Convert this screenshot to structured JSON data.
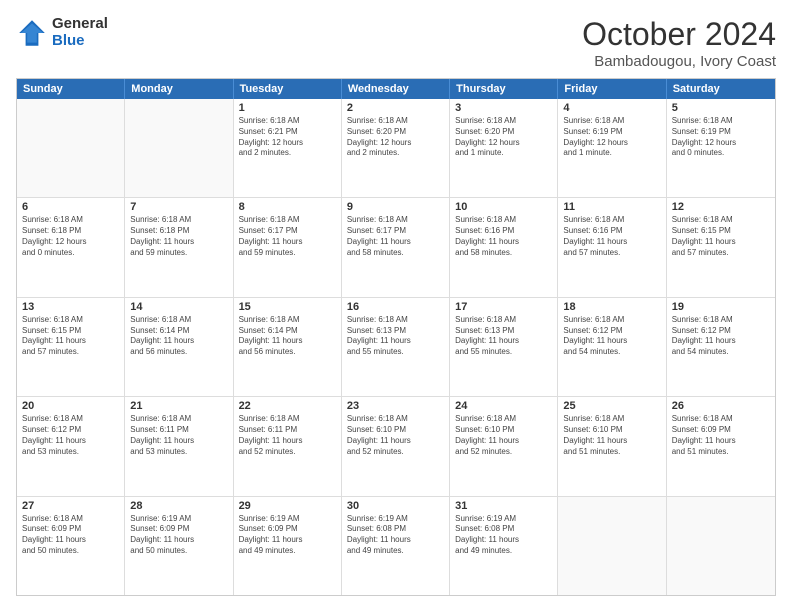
{
  "logo": {
    "general": "General",
    "blue": "Blue"
  },
  "title": "October 2024",
  "location": "Bambadougou, Ivory Coast",
  "header_days": [
    "Sunday",
    "Monday",
    "Tuesday",
    "Wednesday",
    "Thursday",
    "Friday",
    "Saturday"
  ],
  "weeks": [
    [
      {
        "day": "",
        "empty": true,
        "text": ""
      },
      {
        "day": "",
        "empty": true,
        "text": ""
      },
      {
        "day": "1",
        "text": "Sunrise: 6:18 AM\nSunset: 6:21 PM\nDaylight: 12 hours\nand 2 minutes."
      },
      {
        "day": "2",
        "text": "Sunrise: 6:18 AM\nSunset: 6:20 PM\nDaylight: 12 hours\nand 2 minutes."
      },
      {
        "day": "3",
        "text": "Sunrise: 6:18 AM\nSunset: 6:20 PM\nDaylight: 12 hours\nand 1 minute."
      },
      {
        "day": "4",
        "text": "Sunrise: 6:18 AM\nSunset: 6:19 PM\nDaylight: 12 hours\nand 1 minute."
      },
      {
        "day": "5",
        "text": "Sunrise: 6:18 AM\nSunset: 6:19 PM\nDaylight: 12 hours\nand 0 minutes."
      }
    ],
    [
      {
        "day": "6",
        "text": "Sunrise: 6:18 AM\nSunset: 6:18 PM\nDaylight: 12 hours\nand 0 minutes."
      },
      {
        "day": "7",
        "text": "Sunrise: 6:18 AM\nSunset: 6:18 PM\nDaylight: 11 hours\nand 59 minutes."
      },
      {
        "day": "8",
        "text": "Sunrise: 6:18 AM\nSunset: 6:17 PM\nDaylight: 11 hours\nand 59 minutes."
      },
      {
        "day": "9",
        "text": "Sunrise: 6:18 AM\nSunset: 6:17 PM\nDaylight: 11 hours\nand 58 minutes."
      },
      {
        "day": "10",
        "text": "Sunrise: 6:18 AM\nSunset: 6:16 PM\nDaylight: 11 hours\nand 58 minutes."
      },
      {
        "day": "11",
        "text": "Sunrise: 6:18 AM\nSunset: 6:16 PM\nDaylight: 11 hours\nand 57 minutes."
      },
      {
        "day": "12",
        "text": "Sunrise: 6:18 AM\nSunset: 6:15 PM\nDaylight: 11 hours\nand 57 minutes."
      }
    ],
    [
      {
        "day": "13",
        "text": "Sunrise: 6:18 AM\nSunset: 6:15 PM\nDaylight: 11 hours\nand 57 minutes."
      },
      {
        "day": "14",
        "text": "Sunrise: 6:18 AM\nSunset: 6:14 PM\nDaylight: 11 hours\nand 56 minutes."
      },
      {
        "day": "15",
        "text": "Sunrise: 6:18 AM\nSunset: 6:14 PM\nDaylight: 11 hours\nand 56 minutes."
      },
      {
        "day": "16",
        "text": "Sunrise: 6:18 AM\nSunset: 6:13 PM\nDaylight: 11 hours\nand 55 minutes."
      },
      {
        "day": "17",
        "text": "Sunrise: 6:18 AM\nSunset: 6:13 PM\nDaylight: 11 hours\nand 55 minutes."
      },
      {
        "day": "18",
        "text": "Sunrise: 6:18 AM\nSunset: 6:12 PM\nDaylight: 11 hours\nand 54 minutes."
      },
      {
        "day": "19",
        "text": "Sunrise: 6:18 AM\nSunset: 6:12 PM\nDaylight: 11 hours\nand 54 minutes."
      }
    ],
    [
      {
        "day": "20",
        "text": "Sunrise: 6:18 AM\nSunset: 6:12 PM\nDaylight: 11 hours\nand 53 minutes."
      },
      {
        "day": "21",
        "text": "Sunrise: 6:18 AM\nSunset: 6:11 PM\nDaylight: 11 hours\nand 53 minutes."
      },
      {
        "day": "22",
        "text": "Sunrise: 6:18 AM\nSunset: 6:11 PM\nDaylight: 11 hours\nand 52 minutes."
      },
      {
        "day": "23",
        "text": "Sunrise: 6:18 AM\nSunset: 6:10 PM\nDaylight: 11 hours\nand 52 minutes."
      },
      {
        "day": "24",
        "text": "Sunrise: 6:18 AM\nSunset: 6:10 PM\nDaylight: 11 hours\nand 52 minutes."
      },
      {
        "day": "25",
        "text": "Sunrise: 6:18 AM\nSunset: 6:10 PM\nDaylight: 11 hours\nand 51 minutes."
      },
      {
        "day": "26",
        "text": "Sunrise: 6:18 AM\nSunset: 6:09 PM\nDaylight: 11 hours\nand 51 minutes."
      }
    ],
    [
      {
        "day": "27",
        "text": "Sunrise: 6:18 AM\nSunset: 6:09 PM\nDaylight: 11 hours\nand 50 minutes."
      },
      {
        "day": "28",
        "text": "Sunrise: 6:19 AM\nSunset: 6:09 PM\nDaylight: 11 hours\nand 50 minutes."
      },
      {
        "day": "29",
        "text": "Sunrise: 6:19 AM\nSunset: 6:09 PM\nDaylight: 11 hours\nand 49 minutes."
      },
      {
        "day": "30",
        "text": "Sunrise: 6:19 AM\nSunset: 6:08 PM\nDaylight: 11 hours\nand 49 minutes."
      },
      {
        "day": "31",
        "text": "Sunrise: 6:19 AM\nSunset: 6:08 PM\nDaylight: 11 hours\nand 49 minutes."
      },
      {
        "day": "",
        "empty": true,
        "text": ""
      },
      {
        "day": "",
        "empty": true,
        "text": ""
      }
    ]
  ]
}
